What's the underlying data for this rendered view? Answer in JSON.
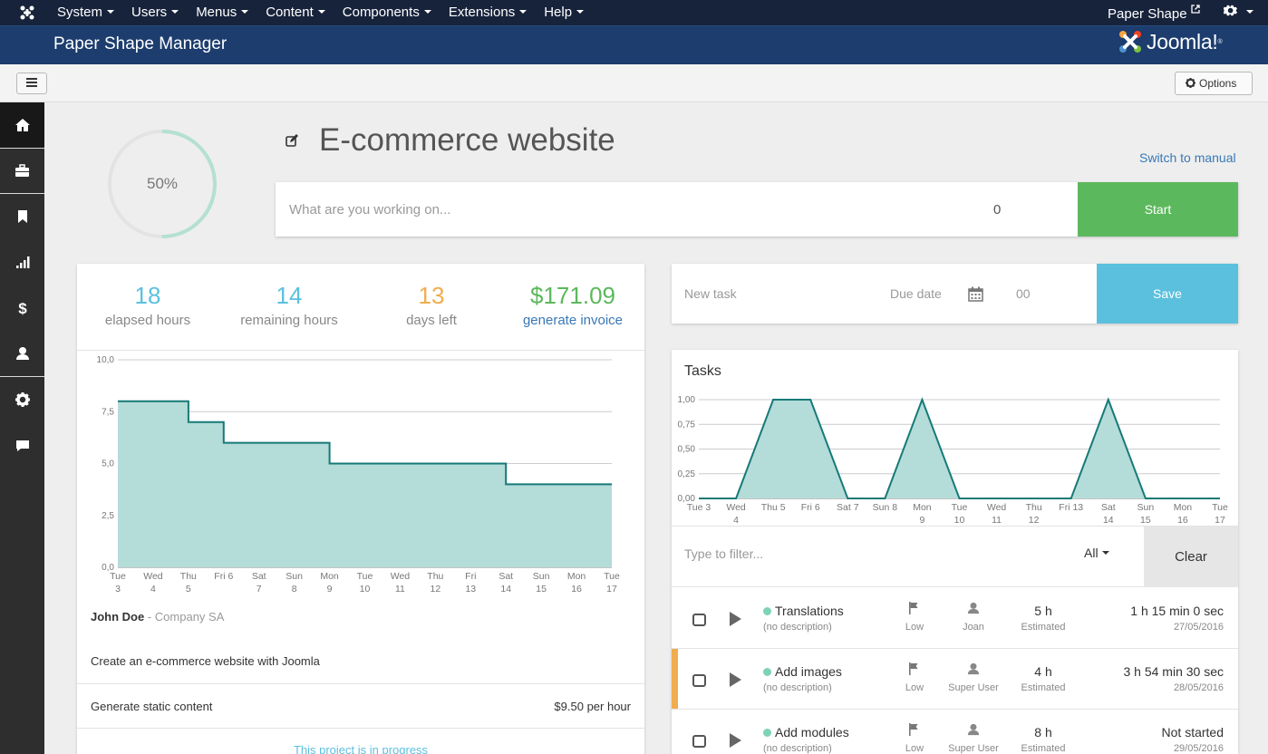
{
  "topnav": {
    "menu": [
      "System",
      "Users",
      "Menus",
      "Content",
      "Components",
      "Extensions",
      "Help"
    ],
    "site_name": "Paper Shape"
  },
  "header": {
    "title": "Paper Shape Manager",
    "brand": "Joomla!"
  },
  "toolbar": {
    "options_label": "Options"
  },
  "sidebar": {
    "items": [
      "home-icon",
      "briefcase-icon",
      "bookmark-icon",
      "bar-chart-icon",
      "dollar-icon",
      "user-icon",
      "gear-icon",
      "comment-icon"
    ]
  },
  "project": {
    "progress_label": "50%",
    "progress": 0.5,
    "title": "E-commerce website",
    "switch_label": "Switch to manual",
    "working_placeholder": "What are you working on...",
    "timer_value": "0",
    "start_label": "Start"
  },
  "stats": {
    "elapsed": {
      "value": "18",
      "label": "elapsed hours"
    },
    "remaining": {
      "value": "14",
      "label": "remaining hours"
    },
    "days": {
      "value": "13",
      "label": "days left"
    },
    "invoice": {
      "value": "$171.09",
      "label": "generate invoice"
    }
  },
  "client": {
    "name": "John Doe",
    "company": " - Company SA"
  },
  "description": "Create an e-commerce website with Joomla",
  "rate": {
    "label": "Generate static content",
    "value": "$9.50 per hour"
  },
  "status": "This project is in progress",
  "newtask": {
    "placeholder": "New task",
    "due_placeholder": "Due date",
    "hours_placeholder": "00",
    "save_label": "Save"
  },
  "tasks": {
    "title": "Tasks",
    "filter_placeholder": "Type to filter...",
    "filter_select": "All",
    "clear_label": "Clear",
    "rows": [
      {
        "name": "Translations",
        "desc": "(no description)",
        "priority": "Low",
        "user": "Joan",
        "estimate": "5 h",
        "estimate_label": "Estimated",
        "time": "1 h 15 min 0 sec",
        "date": "27/05/2016"
      },
      {
        "name": "Add images",
        "desc": "(no description)",
        "priority": "Low",
        "user": "Super User",
        "estimate": "4 h",
        "estimate_label": "Estimated",
        "time": "3 h 54 min 30 sec",
        "date": "28/05/2016"
      },
      {
        "name": "Add modules",
        "desc": "(no description)",
        "priority": "Low",
        "user": "Super User",
        "estimate": "8 h",
        "estimate_label": "Estimated",
        "time": "Not started",
        "date": "29/05/2016"
      }
    ]
  },
  "colors": {
    "accent": "#5cb85c",
    "info": "#5bc0de",
    "chart_fill": "#b4dcd9",
    "chart_line": "#167a77",
    "warning": "#f0ad4e"
  },
  "chart_data": [
    {
      "type": "area",
      "title": "",
      "categories": [
        [
          "Tue",
          "3"
        ],
        [
          "Wed",
          "4"
        ],
        [
          "Thu",
          "5"
        ],
        [
          "Fri 6"
        ],
        [
          "Sat",
          "7"
        ],
        [
          "Sun",
          "8"
        ],
        [
          "Mon",
          "9"
        ],
        [
          "Tue",
          "10"
        ],
        [
          "Wed",
          "11"
        ],
        [
          "Thu",
          "12"
        ],
        [
          "Fri",
          "13"
        ],
        [
          "Sat",
          "14"
        ],
        [
          "Sun",
          "15"
        ],
        [
          "Mon",
          "16"
        ],
        [
          "Tue",
          "17"
        ]
      ],
      "series": [
        {
          "values": [
            8,
            8,
            7,
            6,
            6,
            6,
            5,
            5,
            5,
            5,
            5,
            4,
            4,
            4,
            4
          ]
        }
      ],
      "step": true,
      "ylim": [
        0,
        10
      ],
      "yticks": [
        "0,0",
        "2,5",
        "5,0",
        "7,5",
        "10,0"
      ],
      "grid": true
    },
    {
      "type": "area",
      "title": "",
      "categories": [
        [
          "Tue 3"
        ],
        [
          "Wed",
          "4"
        ],
        [
          "Thu 5"
        ],
        [
          "Fri 6"
        ],
        [
          "Sat 7"
        ],
        [
          "Sun 8"
        ],
        [
          "Mon",
          "9"
        ],
        [
          "Tue",
          "10"
        ],
        [
          "Wed",
          "11"
        ],
        [
          "Thu",
          "12"
        ],
        [
          "Fri 13"
        ],
        [
          "Sat",
          "14"
        ],
        [
          "Sun",
          "15"
        ],
        [
          "Mon",
          "16"
        ],
        [
          "Tue",
          "17"
        ]
      ],
      "series": [
        {
          "values": [
            0,
            0,
            1,
            1,
            0,
            0,
            1,
            0,
            0,
            0,
            0,
            1,
            0,
            0,
            0
          ]
        }
      ],
      "ylim": [
        0,
        1
      ],
      "yticks": [
        "0,00",
        "0,25",
        "0,50",
        "0,75",
        "1,00"
      ],
      "grid": true
    }
  ]
}
